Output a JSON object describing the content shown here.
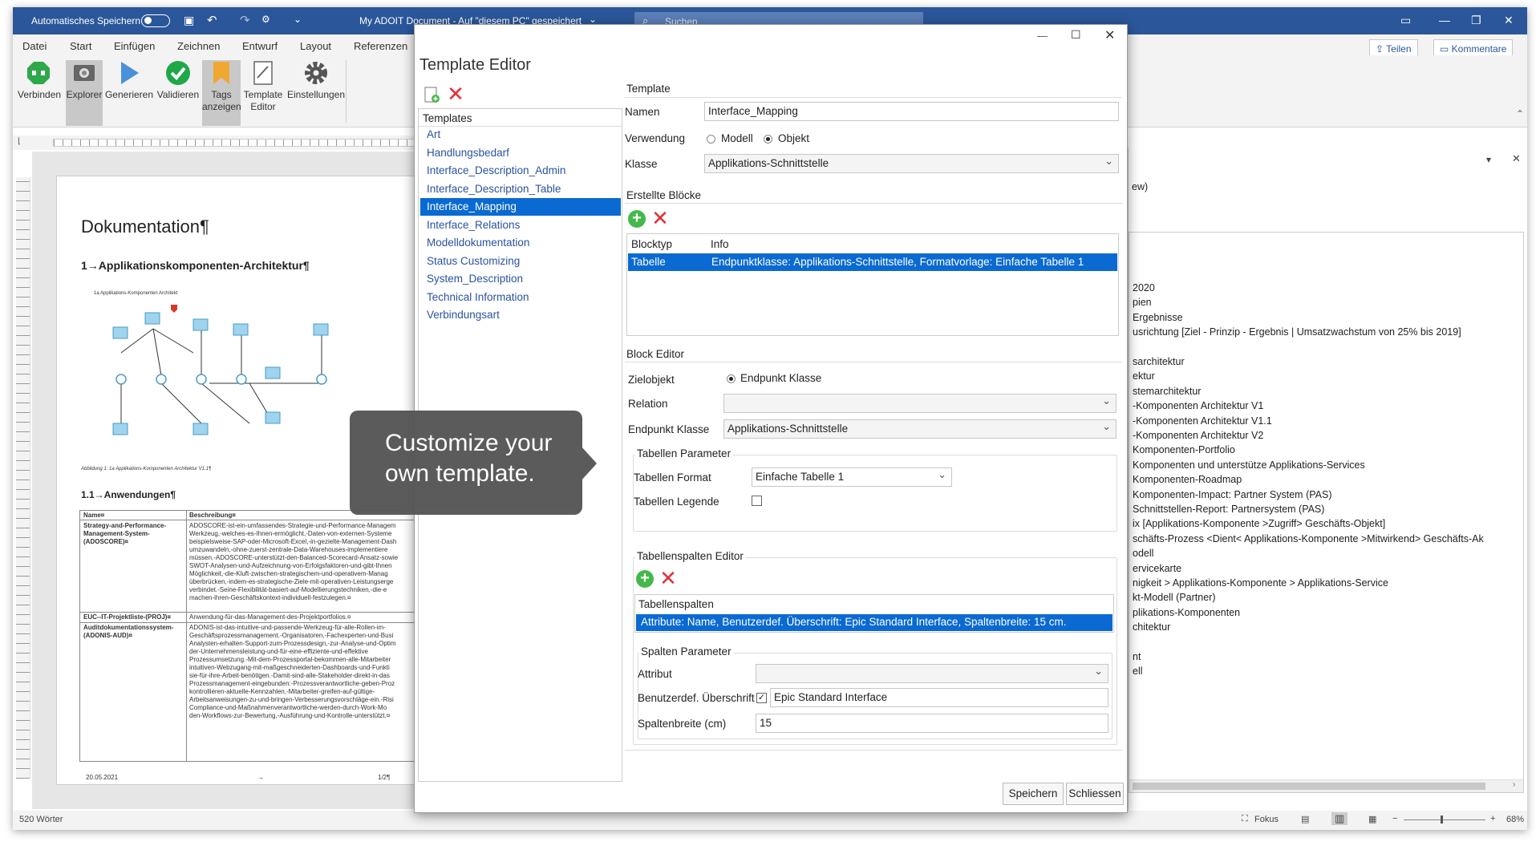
{
  "word": {
    "titlebar": {
      "autosave_label": "Automatisches Speichern",
      "doc_title": "My ADOIT Document - Auf \"diesem PC\" gespeichert",
      "search_placeholder": "Suchen"
    },
    "menu": [
      "Datei",
      "Start",
      "Einfügen",
      "Zeichnen",
      "Entwurf",
      "Layout",
      "Referenzen"
    ],
    "share_label": "Teilen",
    "comments_label": "Kommentare",
    "ribbon": [
      {
        "label": "Verbinden",
        "icon": "connect-icon",
        "color": "#2ea84a"
      },
      {
        "label": "Explorer",
        "icon": "explorer-icon",
        "color": "#555555"
      },
      {
        "label": "Generieren",
        "icon": "play-icon",
        "color": "#4a90d9"
      },
      {
        "label": "Validieren",
        "icon": "check-icon",
        "color": "#1fa848"
      },
      {
        "label": "Tags anzeigen",
        "icon": "tag-icon",
        "color": "#f0a830"
      },
      {
        "label": "Template Editor",
        "icon": "template-icon",
        "color": "#666666"
      },
      {
        "label": "Einstellungen",
        "icon": "gear-icon",
        "color": "#555555"
      }
    ],
    "status": {
      "words": "520 Wörter",
      "focus": "Fokus",
      "zoom": "68%"
    },
    "document": {
      "heading": "Dokumentation¶",
      "h1": "1→Applikationskomponenten-Architektur¶",
      "fig_caption_top": "1a Applikations-Komponenten Architekt",
      "fig_caption": "Abbildung 1: 1a Applikations-Komponenten Architektur V1.1¶",
      "h2": "1.1→Anwendungen¶",
      "table_headers": [
        "Name¤",
        "Beschreibung¤"
      ],
      "rows": [
        {
          "name": "Strategy-and-Performance-Management-System-(ADOSCORE)¤",
          "desc": [
            "ADOSCORE-ist-ein-umfassendes-Strategie-und-Performance-Managem",
            "Werkzeug,-welches-es-Ihnen-ermöglicht,-Daten-von-externen-Systeme",
            "beispielsweise-SAP-oder-Microsoft-Excel,-in-gezielte-Management-Dash",
            "umzuwandeln,-ohne-zuerst-zentrale-Data-Warehouses-implementiere",
            "müssen.-ADOSCORE-unterstützt-den-Balanced-Scorecard-Ansatz-sowie",
            "SWOT-Analysen-und-Aufzeichnung-von-Erfolgsfaktoren-und-gibt-Ihnen",
            "Möglichkeit,-die-Kluft-zwischen-strategischem-und-operativem-Manag",
            "überbrücken,-indem-es-strategische-Ziele-mit-operativen-Leistungserge",
            "verbindet.-Seine-Flexibilität-basiert-auf-Modellierungstechniken,-die-e",
            "machen-ihren-Geschäftskontext-individuell-festzulegen.¤"
          ]
        },
        {
          "name": "EUC--IT-Projektliste-(PROJ)¤",
          "desc": [
            "Anwendung-für-das-Management-des-Projektportfolios.¤"
          ]
        },
        {
          "name": "Auditdokumentationssystem-(ADONIS-AUD)¤",
          "desc": [
            "ADONIS-ist-das-intuitive-und-passende-Werkzeug-für-alle-Rollen-im-",
            "Geschäftsprozessmanagement.-Organisatoren,-Fachexperten-und-Busi",
            "Analysten-erhalten-Support-zum-Prozessdesign,-zur-Analyse-und-Optim",
            "der-Unternehmensleistung-und-für-eine-effiziente-und-effektive",
            "Prozessumsetzung.-Mit-dem-Prozessportal-bekommen-alle-Mitarbeiter",
            "intuitiven-Webzugang-mit-maßgeschneiderten-Dashboards-und-Funkti",
            "sie-für-ihre-Arbeit-benötigen.-Damit-sind-alle-Stakeholder-direkt-in-das",
            "Prozessmanagement-eingebunden:-Prozessverantwortliche-geben-Proz",
            "kontrollieren-aktuelle-Kennzahlen,-Mitarbeiter-greifen-auf-gültige-",
            "Arbeitsanweisungen-zu-und-bringen-Verbesserungsvorschläge-ein.-Risi",
            "Compliance-und-Maßnahmenverantwortliche-werden-durch-Work-Mo",
            "den-Workflows-zur-Bewertung,-Ausführung-und-Kontrolle-unterstützt.¤"
          ]
        }
      ],
      "footer_date": "20.05.2021",
      "footer_arrow": "→",
      "footer_page": "1/2¶"
    },
    "right_pane": {
      "top_fragment": "ew)",
      "lines": [
        "2020",
        "pien",
        "Ergebnisse",
        "usrichtung [Ziel - Prinzip - Ergebnis | Umsatzwachstum von 25% bis 2019]",
        "",
        "sarchitektur",
        "ektur",
        "stemarchitektur",
        "-Komponenten Architektur V1",
        "-Komponenten Architektur V1.1",
        "-Komponenten Architektur V2",
        "Komponenten-Portfolio",
        "Komponenten und unterstütze Applikations-Services",
        "Komponenten-Roadmap",
        "Komponenten-Impact: Partner System (PAS)",
        "Schnittstellen-Report: Partnersystem (PAS)",
        "ix [Applikations-Komponente >Zugriff> Geschäfts-Objekt]",
        "schäfts-Prozess <Dient< Applikations-Komponente >Mitwirkend> Geschäfts-Ak",
        "odell",
        "ervicekarte",
        "nigkeit > Applikations-Komponente > Applikations-Service",
        "kt-Modell (Partner)",
        "plikations-Komponenten",
        "chitektur",
        "",
        "nt",
        "ell"
      ]
    }
  },
  "dialog": {
    "title": "Template Editor",
    "templates_header": "Templates",
    "templates": [
      "Art",
      "Handlungsbedarf",
      "Interface_Description_Admin",
      "Interface_Description_Table",
      "Interface_Mapping",
      "Interface_Relations",
      "Modelldokumentation",
      "Status Customizing",
      "System_Description",
      "Technical Information",
      "Verbindungsart"
    ],
    "selected_index": 4,
    "template_group": "Template",
    "name_label": "Namen",
    "name_value": "Interface_Mapping",
    "usage_label": "Verwendung",
    "usage_opt1": "Modell",
    "usage_opt2": "Objekt",
    "class_label": "Klasse",
    "class_value": "Applikations-Schnittstelle",
    "blocks_group": "Erstellte Blöcke",
    "blocks_cols": [
      "Blocktyp",
      "Info"
    ],
    "blocks_row": {
      "type": "Tabelle",
      "info": "Endpunktklasse: Applikations-Schnittstelle, Formatvorlage: Einfache Tabelle 1"
    },
    "block_editor": "Block Editor",
    "target_label": "Zielobjekt",
    "target_value": "Endpunkt Klasse",
    "relation_label": "Relation",
    "relation_value": "",
    "endpoint_label": "Endpunkt Klasse",
    "endpoint_value": "Applikations-Schnittstelle",
    "table_params": "Tabellen Parameter",
    "format_label": "Tabellen Format",
    "format_value": "Einfache Tabelle 1",
    "legend_label": "Tabellen Legende",
    "cols_editor": "Tabellenspalten Editor",
    "cols_header": "Tabellenspalten",
    "cols_row": "Attribute: Name, Benutzerdef. Überschrift: Epic Standard Interface, Spaltenbreite: 15 cm.",
    "col_params": "Spalten Parameter",
    "attr_label": "Attribut",
    "attr_value": "",
    "custom_label": "Benutzerdef. Überschrift",
    "custom_value": "Epic Standard Interface",
    "width_label": "Spaltenbreite (cm)",
    "width_value": "15",
    "save_btn": "Speichern",
    "close_btn": "Schliessen"
  },
  "callout": {
    "line1": "Customize your",
    "line2": "own template."
  }
}
